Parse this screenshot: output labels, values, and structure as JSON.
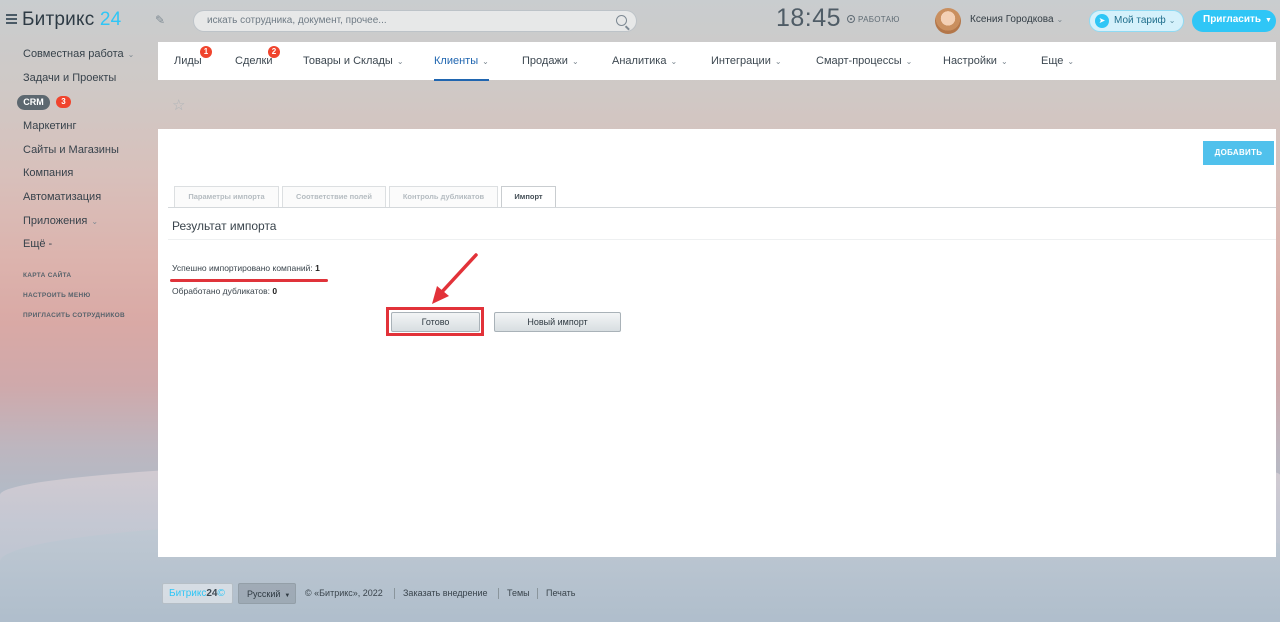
{
  "header": {
    "logo_text": "Битрикс",
    "logo_num": "24",
    "search_placeholder": "искать сотрудника, документ, прочее...",
    "clock": "18:45",
    "work_status": "РАБОТАЮ",
    "user_name": "Ксения Городкова",
    "tariff_label": "Мой тариф",
    "invite_label": "Пригласить"
  },
  "sidebar": {
    "items": [
      {
        "label": "Совместная работа"
      },
      {
        "label": "Задачи и Проекты"
      },
      {
        "label": "CRM",
        "badge": "3"
      },
      {
        "label": "Маркетинг"
      },
      {
        "label": "Сайты и Магазины"
      },
      {
        "label": "Компания"
      },
      {
        "label": "Автоматизация"
      },
      {
        "label": "Приложения"
      },
      {
        "label": "Ещё -"
      }
    ],
    "links": [
      "КАРТА САЙТА",
      "НАСТРОИТЬ МЕНЮ",
      "ПРИГЛАСИТЬ СОТРУДНИКОВ"
    ]
  },
  "crm_nav": {
    "tabs": [
      {
        "label": "Лиды",
        "badge": "1"
      },
      {
        "label": "Сделки",
        "badge": "2"
      },
      {
        "label": "Товары и Склады"
      },
      {
        "label": "Клиенты"
      },
      {
        "label": "Продажи"
      },
      {
        "label": "Аналитика"
      },
      {
        "label": "Интеграции"
      },
      {
        "label": "Смарт-процессы"
      },
      {
        "label": "Настройки"
      },
      {
        "label": "Еще"
      }
    ],
    "active": "Клиенты"
  },
  "main": {
    "add_label": "ДОБАВИТЬ",
    "import_tabs": [
      "Параметры импорта",
      "Соответствие полей",
      "Контроль дубликатов",
      "Импорт"
    ],
    "active_tab": "Импорт",
    "result_title": "Результат импорта",
    "success_label": "Успешно импортировано компаний:",
    "success_value": "1",
    "duplicates_label": "Обработано дубликатов:",
    "duplicates_value": "0",
    "done_label": "Готово",
    "new_import_label": "Новый импорт"
  },
  "footer": {
    "logo_text": "Битрикс",
    "logo_num": "24",
    "logo_mark": "©",
    "language": "Русский",
    "copyright": "© «Битрикс», 2022",
    "order_link": "Заказать внедрение",
    "themes_link": "Темы",
    "print_link": "Печать"
  },
  "colors": {
    "accent": "#2fc6f6",
    "active_tab": "#2066b0",
    "badge": "#f0442d",
    "highlight": "#e23239"
  }
}
